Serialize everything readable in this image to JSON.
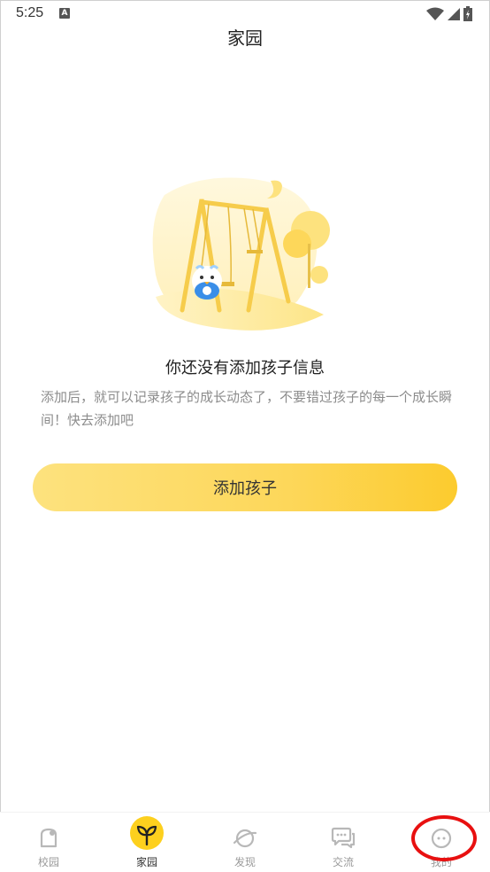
{
  "status_bar": {
    "time": "5:25",
    "indicator": "A",
    "icons": [
      "wifi-icon",
      "signal-icon",
      "battery-icon"
    ]
  },
  "header": {
    "title": "家园"
  },
  "empty_state": {
    "heading": "你还没有添加孩子信息",
    "description": "添加后，就可以记录孩子的成长动态了，不要错过孩子的每一个成长瞬间！快去添加吧",
    "illustration_icon": "swing-illustration"
  },
  "actions": {
    "add_child_label": "添加孩子"
  },
  "bottom_nav": {
    "items": [
      {
        "label": "校园",
        "icon": "campus-icon",
        "active": false
      },
      {
        "label": "家园",
        "icon": "sprout-icon",
        "active": true
      },
      {
        "label": "发现",
        "icon": "planet-icon",
        "active": false
      },
      {
        "label": "交流",
        "icon": "chat-icon",
        "active": false
      },
      {
        "label": "我的",
        "icon": "profile-face-icon",
        "active": false
      }
    ]
  },
  "colors": {
    "accent": "#fdd01e",
    "button_gradient_start": "#fde27e",
    "button_gradient_end": "#fccb2e",
    "highlight": "#e81010"
  }
}
